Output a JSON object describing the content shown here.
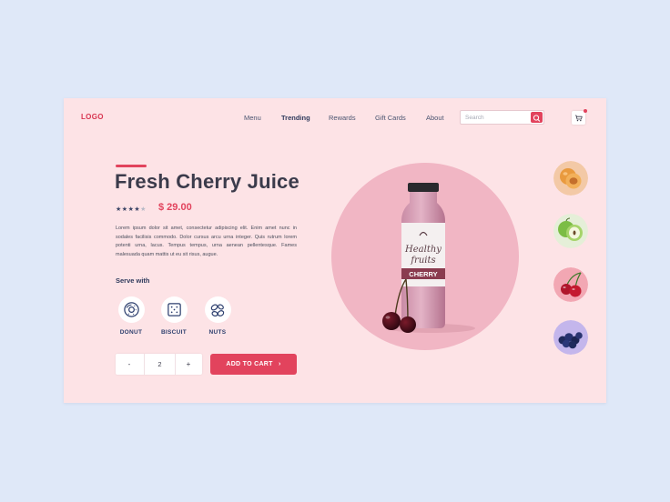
{
  "header": {
    "logo": "LOGO",
    "nav": [
      {
        "label": "Menu",
        "active": false
      },
      {
        "label": "Trending",
        "active": true
      },
      {
        "label": "Rewards",
        "active": false
      },
      {
        "label": "Gift Cards",
        "active": false
      },
      {
        "label": "About",
        "active": false
      }
    ],
    "search_placeholder": "Search",
    "search_icon": "search-icon",
    "cart_icon": "cart-icon"
  },
  "product": {
    "title": "Fresh Cherry Juice",
    "rating": 4,
    "rating_max": 5,
    "price": "$ 29.00",
    "description": "Lorem ipsum dolor sit amet, consectetur adipiscing elit. Enim amet nunc in sodales facilisis commodo. Dolor cursus arcu urna integer. Quis rutrum lorem potenti urna, lacus. Tempus tempus, urna aenean pellentesque. Fames malesuada quam mattis ut eu sit risus, augue.",
    "bottle_label_line1": "Healthy",
    "bottle_label_line2": "fruits",
    "bottle_flavor": "CHERRY"
  },
  "serve_with": {
    "label": "Serve with",
    "items": [
      {
        "label": "DONUT",
        "icon": "donut-icon"
      },
      {
        "label": "BISCUIT",
        "icon": "biscuit-icon"
      },
      {
        "label": "NUTS",
        "icon": "nuts-icon"
      }
    ]
  },
  "cart_controls": {
    "decrement": "-",
    "quantity": "2",
    "increment": "+",
    "add_to_cart": "ADD TO CART",
    "add_to_cart_arrow": "›"
  },
  "flavors": [
    {
      "name": "apricot",
      "bg": "#f3c9a6"
    },
    {
      "name": "apple",
      "bg": "#e5efd8"
    },
    {
      "name": "cherry",
      "bg": "#f2a7b3"
    },
    {
      "name": "blueberry",
      "bg": "#c4b6ec"
    }
  ],
  "colors": {
    "accent": "#e2435d",
    "card_bg": "#fde3e6",
    "page_bg": "#dfe8f8",
    "hero_circle": "#f1b6c4"
  }
}
